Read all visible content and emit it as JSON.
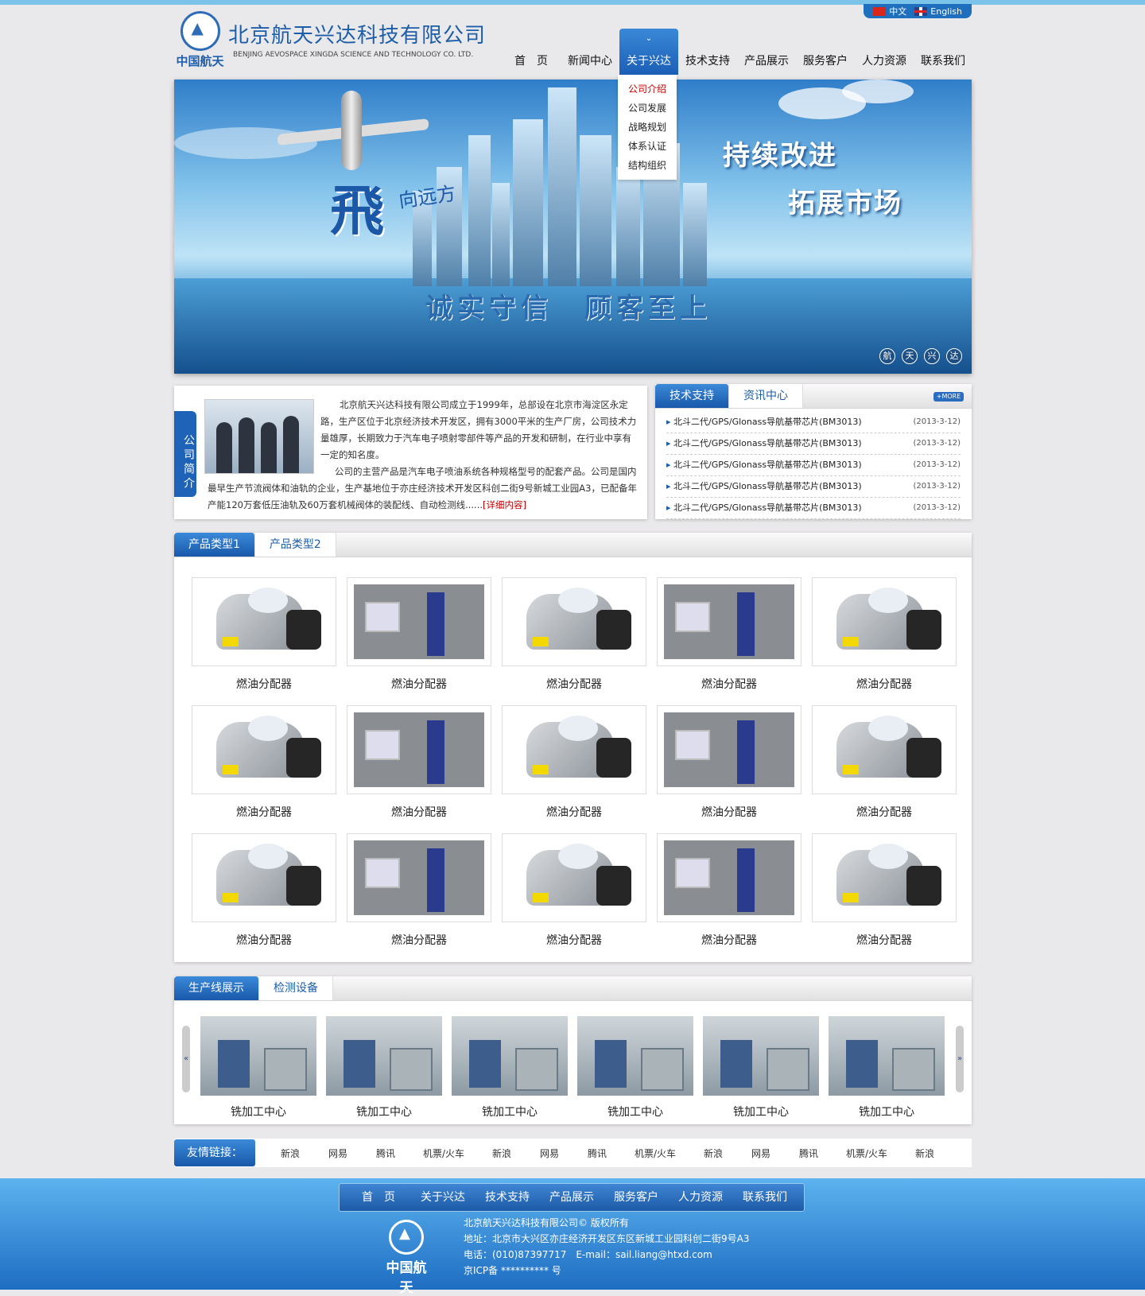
{
  "header": {
    "company_cn": "北京航天兴达科技有限公司",
    "company_en": "BENJING AEVOSPACE XINGDA SCIENCE AND TECHNOLOGY CO. LTD.",
    "logo_text": "中国航天",
    "lang_cn": "中文",
    "lang_en": "English"
  },
  "nav": {
    "items": [
      "首　页",
      "新闻中心",
      "关于兴达",
      "技术支持",
      "产品展示",
      "服务客户",
      "人力资源",
      "联系我们"
    ],
    "active_index": 2,
    "dropdown": [
      "公司介绍",
      "公司发展",
      "战略规划",
      "体系认证",
      "结构组织"
    ]
  },
  "banner": {
    "slogan1": "持续改进",
    "slogan2": "拓展市场",
    "slogan3": "诚实守信　顾客至上",
    "fly_big": "飛",
    "fly_small": "向远方",
    "dots": [
      "航",
      "天",
      "兴",
      "达"
    ]
  },
  "intro": {
    "tab_label": "公司简介",
    "para1": "北京航天兴达科技有限公司成立于1999年，总部设在北京市海淀区永定路，生产区位于北京经济技术开发区，拥有3000平米的生产厂房，公司技术力量雄厚，长期致力于汽车电子喷射零部件等产品的开发和研制，在行业中享有一定的知名度。",
    "para2": "公司的主营产品是汽车电子喷油系统各种规格型号的配套产品。公司是国内最早生产节流阀体和油轨的企业，生产基地位于亦庄经济技术开发区科创二街9号新城工业园A3，已配备年产能120万套低压油轨及60万套机械阀体的装配线、自动检测线......",
    "more": "[详细内容]"
  },
  "news": {
    "tabs": [
      "技术支持",
      "资讯中心"
    ],
    "more": "+MORE",
    "items": [
      {
        "title": "北斗二代/GPS/Glonass导航基带芯片(BM3013)",
        "date": "(2013-3-12)"
      },
      {
        "title": "北斗二代/GPS/Glonass导航基带芯片(BM3013)",
        "date": "(2013-3-12)"
      },
      {
        "title": "北斗二代/GPS/Glonass导航基带芯片(BM3013)",
        "date": "(2013-3-12)"
      },
      {
        "title": "北斗二代/GPS/Glonass导航基带芯片(BM3013)",
        "date": "(2013-3-12)"
      },
      {
        "title": "北斗二代/GPS/Glonass导航基带芯片(BM3013)",
        "date": "(2013-3-12)"
      }
    ]
  },
  "products": {
    "tabs": [
      "产品类型1",
      "产品类型2"
    ],
    "items": [
      "燃油分配器",
      "燃油分配器",
      "燃油分配器",
      "燃油分配器",
      "燃油分配器",
      "燃油分配器",
      "燃油分配器",
      "燃油分配器",
      "燃油分配器",
      "燃油分配器",
      "燃油分配器",
      "燃油分配器",
      "燃油分配器",
      "燃油分配器",
      "燃油分配器"
    ]
  },
  "production": {
    "tabs": [
      "生产线展示",
      "检测设备"
    ],
    "items": [
      "铣加工中心",
      "铣加工中心",
      "铣加工中心",
      "铣加工中心",
      "铣加工中心",
      "铣加工中心"
    ]
  },
  "links": {
    "title": "友情链接：",
    "items": [
      "新浪",
      "网易",
      "腾讯",
      "机票/火车",
      "新浪",
      "网易",
      "腾讯",
      "机票/火车",
      "新浪",
      "网易",
      "腾讯",
      "机票/火车",
      "新浪"
    ]
  },
  "footer": {
    "nav": [
      "首　页",
      "关于兴达",
      "技术支持",
      "产品展示",
      "服务客户",
      "人力资源",
      "联系我们"
    ],
    "logo_text": "中国航天",
    "copyright": "北京航天兴达科技有限公司© 版权所有",
    "address": "地址：北京市大兴区亦庄经济开发区东区新城工业园科创二街9号A3",
    "contact": "电话：(010)87397717　E-mail：sail.liang@htxd.com",
    "icp": "京ICP备 ********** 号"
  }
}
